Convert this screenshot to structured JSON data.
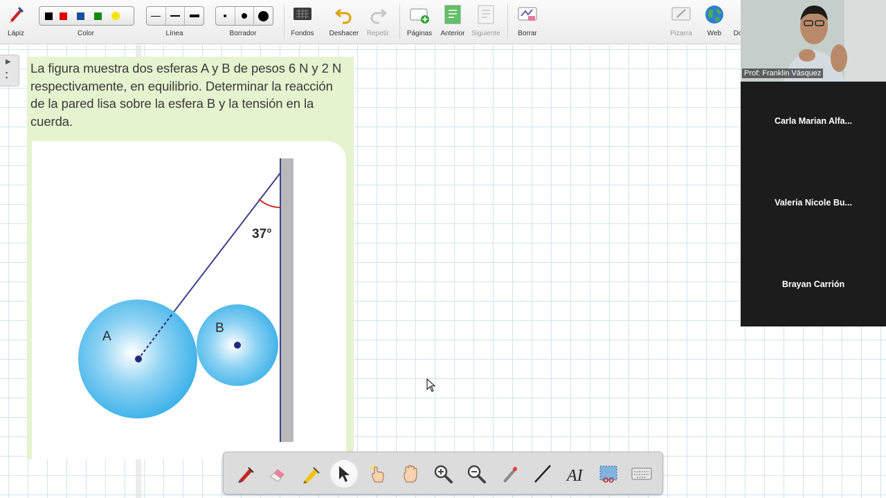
{
  "toolbar": {
    "pencil_label": "Lápiz",
    "color_label": "Color",
    "line_label": "Línea",
    "eraser_label": "Borrador",
    "backgrounds_label": "Fondos",
    "undo_label": "Deshacer",
    "redo_label": "Repetir",
    "pages_label": "Páginas",
    "previous_label": "Anterior",
    "next_label": "Siguiente",
    "clear_label": "Borrar",
    "whiteboard_label": "Pizarra",
    "web_label": "Web",
    "doc_label": "Do",
    "colors": [
      "#000000",
      "#e00000",
      "#1a4f9c",
      "#138a13",
      "#f7e300"
    ]
  },
  "problem": {
    "text": "La figura muestra dos esferas A y B de pesos 6 N y 2 N respectivamente, en equilibrio. Determinar la reacción de la pared lisa sobre la esfera B y la tensión en la cuerda.",
    "angle_label": "37°",
    "sphere_a_label": "A",
    "sphere_b_label": "B",
    "sphere_color": "#34aee8"
  },
  "video": {
    "presenter_name": "Prof: Franklin Vásquez"
  },
  "participants": [
    {
      "name": "Carla Marian Alfa..."
    },
    {
      "name": "Valeria Nicole Bu..."
    },
    {
      "name": "Brayan Carrión"
    }
  ],
  "bottom_tools": [
    "pen-tool-icon",
    "eraser-tool-icon",
    "highlighter-tool-icon",
    "select-cursor-icon",
    "pointer-hand-icon",
    "pan-hand-icon",
    "zoom-in-icon",
    "zoom-out-icon",
    "laser-pointer-icon",
    "line-tool-icon",
    "text-tool-icon",
    "screenshot-icon",
    "keyboard-icon"
  ]
}
